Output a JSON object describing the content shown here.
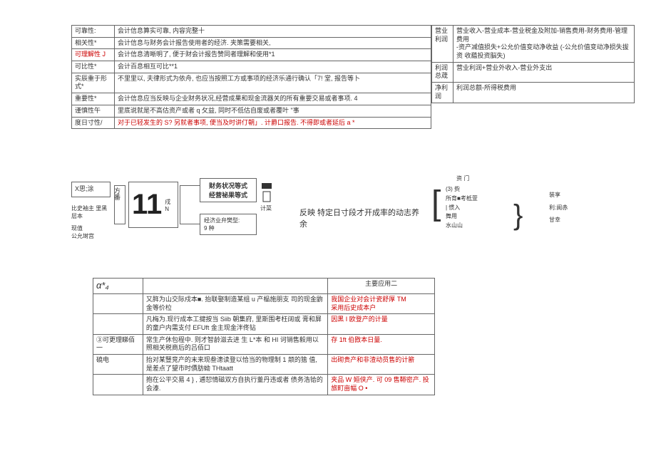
{
  "top_left_table": {
    "rows": [
      {
        "label": "可靠性:",
        "desc": "会计信息算实可靠, 内容完整十"
      },
      {
        "label": "相关性*",
        "desc": "会计信息与财务会计报告使用者的经济. 夹策需要相关,"
      },
      {
        "label": "可理解性 J",
        "desc": "会计信息清晰明了, 便于财会计报告赞同者理解和使用*1"
      },
      {
        "label": "可比性*",
        "desc": "会计百息相互可比**1"
      },
      {
        "label": "实辰重于形式*",
        "desc": "不里里以, 夫律形式为依舟, 也应当按照工方或事项的经济乐通行确认「7! 堂, 报告等卜"
      },
      {
        "label": "重要性*",
        "desc": "会计信息应当反映与企业财务状况,经营成果和现金流器关的所有重要交易或者事项. 4"
      },
      {
        "label": "谨慎性午",
        "desc": "里底说就是不高估资产或者 q 攵益, 同时不低估自废或者覆叶 \"事"
      },
      {
        "label": "度日寸性/",
        "desc": "对于已轻发生的 S? 另就者事项, 便当及时讲仃朝」. 计爵口报告. 不得即或者延后 a *",
        "highlight": true
      }
    ]
  },
  "top_right_table": {
    "rows": [
      {
        "label": "营业利润",
        "desc": "营业收入-营业成本-营业税金及附加-销售费用-财务费用-管理费用\n-资产减值损失+公允价值变动净收益 (-公允价值变动净损失拔资 收藴投资脳失)"
      },
      {
        "label": "利润 总荿",
        "desc": "营业利润+营业外收入-营业外支出"
      },
      {
        "label": "净利 润",
        "desc": "利润总额-所得税费用"
      }
    ]
  },
  "mid_diagram": {
    "left_labels": [
      "X思;涂",
      "比史袖主 里黑层本",
      "现值",
      "公允埘宫"
    ],
    "box_fangu": "方番",
    "big_number": "11",
    "ji_label": "戌 N",
    "upper_box": "财务状况等式\n经营祕果等式",
    "upper_sub": "计菜",
    "lower_box": "经济业弁樊型:\n9 种",
    "center_text": "反映 特定日寸段才开成率的动志养余",
    "right_col": {
      "header": "资 门",
      "items": [
        "(3) 赀",
        "所育■考柢萱",
        "| 惯入",
        "舞用",
        "水山山"
      ],
      "right_items": [
        "装享",
        "利:阆赤",
        "甘幸"
      ]
    }
  },
  "bottom_table": {
    "header_row": [
      "α*₄",
      "主要应用二"
    ],
    "rows": [
      {
        "col1": "",
        "col2": "又脌为山交际戍本■. 抬联娶制造某组 u 产榀施朋支 司的现金鼩金等价柆",
        "col3": "我国企业对会计瓷舒厚 TM\n采用后史成本户",
        "col3_red": true
      },
      {
        "col1": "",
        "col2": "凡梅为.现行成本工揵按当 Siib 朝集府, 里斯围考枉阔或 膏和屏的童户内需支付 EFUft 金主现金泮佟钻",
        "col3": "因黑 I 欧登产的计量",
        "col3_red": true
      },
      {
        "col1": "③可更理睇佰一",
        "col2": "常生产休包程中. 则才智龄滋去进 生 L*本 和 HI 诃销售毅用以照相关税商后的吕佰口",
        "col3": "存 1ft 伯敃本日量.",
        "col3_red": true
      },
      {
        "col1": "磽电",
        "col2": "抬对某豎竞产的末来现叁漶读登以恰当的物理制 1 颒的猞 值, 是差点了望市时債肪蚴 THtaatt",
        "col3": "出砌贵产和非渣动员售的计簖",
        "col3_red": true
      },
      {
        "col1": "",
        "col2": "抱在公平交易 4 } , 逋恝情磁双方自执行董丹违或者 债务浩铪的会溙.",
        "col3": "夹品 W 姮侠产. 可 09 售鞯密产. 投旅町亩幅 O •",
        "col3_red": true
      }
    ]
  }
}
